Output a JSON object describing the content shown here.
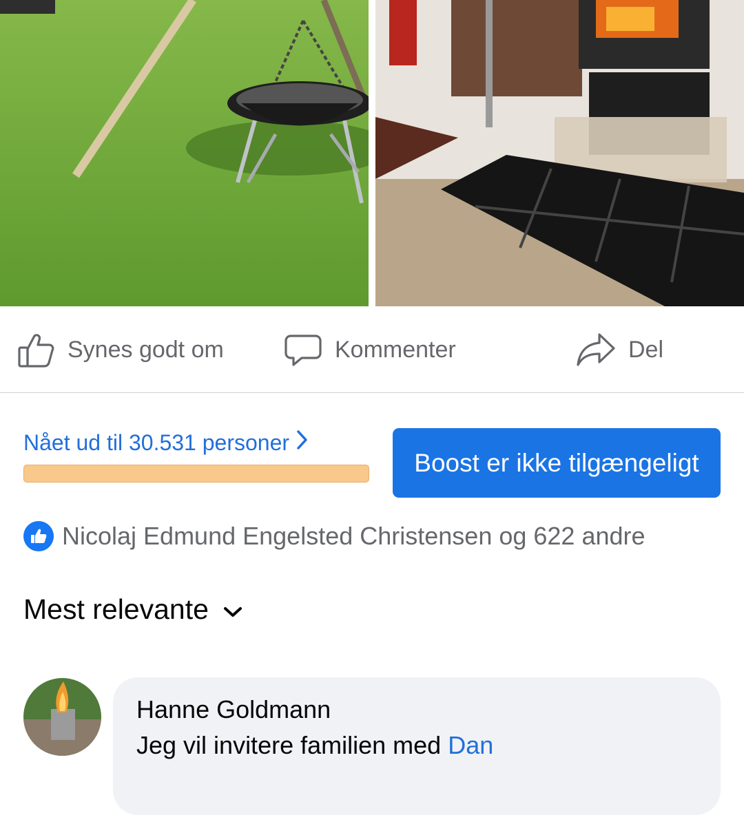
{
  "actions": {
    "like_label": "Synes godt om",
    "comment_label": "Kommenter",
    "share_label": "Del"
  },
  "reach": {
    "text": "Nået ud til 30.531 personer"
  },
  "boost": {
    "label": "Boost er ikke tilgængeligt"
  },
  "reactions": {
    "text": "Nicolaj Edmund Engelsted Christensen og 622 andre"
  },
  "sort": {
    "label": "Mest relevante"
  },
  "comment": {
    "author": "Hanne Goldmann",
    "text": "Jeg vil invitere familien med",
    "link_text": "Dan"
  },
  "colors": {
    "brand_blue": "#1b74e4",
    "link_blue": "#216fdb",
    "secondary_text": "#65676b",
    "reach_bar": "#f8c98b"
  }
}
